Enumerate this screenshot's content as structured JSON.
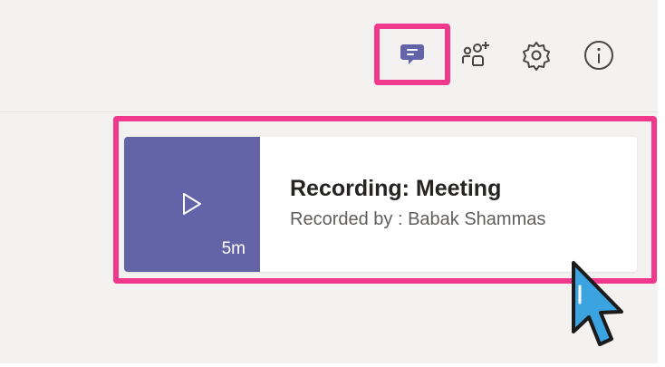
{
  "header": {
    "chat_icon": "chat-icon",
    "people_icon": "add-people-icon",
    "settings_icon": "gear-icon",
    "info_icon": "info-icon"
  },
  "recording": {
    "title": "Recording: Meeting",
    "recorded_by": "Recorded by : Babak Shammas",
    "duration": "5m",
    "thumbnail_icon": "play-icon"
  },
  "colors": {
    "accent": "#6264a7",
    "highlight": "#f0398c",
    "cursor": "#3ba3e0"
  }
}
